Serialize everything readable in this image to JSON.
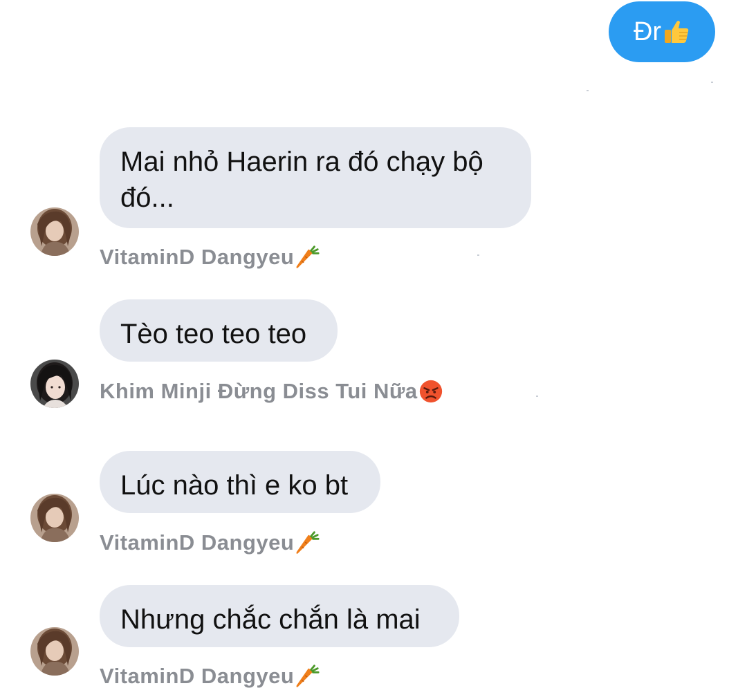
{
  "messages": [
    {
      "direction": "outgoing",
      "text": "Đr",
      "emoji_icon": "thumbs-up-icon",
      "bubble_color": "#2b9cf2"
    },
    {
      "direction": "incoming",
      "text": "Mai nhỏ Haerin ra đó chạy bộ đó...",
      "sender": "VitaminD Dangyeu",
      "sender_emoji_icon": "carrot-icon",
      "avatar": "avatar-vitamind"
    },
    {
      "direction": "incoming",
      "text": "Tèo teo teo teo",
      "sender": "Khim Minji Đừng Diss Tui Nữa",
      "sender_emoji_icon": "angry-face-icon",
      "avatar": "avatar-khim-minji"
    },
    {
      "direction": "incoming",
      "text": "Lúc nào thì e ko bt",
      "sender": "VitaminD Dangyeu",
      "sender_emoji_icon": "carrot-icon",
      "avatar": "avatar-vitamind"
    },
    {
      "direction": "incoming",
      "text": "Nhưng chắc chắn là mai",
      "sender": "VitaminD Dangyeu",
      "sender_emoji_icon": "carrot-icon",
      "avatar": "avatar-vitamind"
    }
  ],
  "colors": {
    "incoming_bubble": "#e5e8ef",
    "sender_name": "#8a8d93",
    "outgoing_bubble": "#2b9cf2"
  }
}
